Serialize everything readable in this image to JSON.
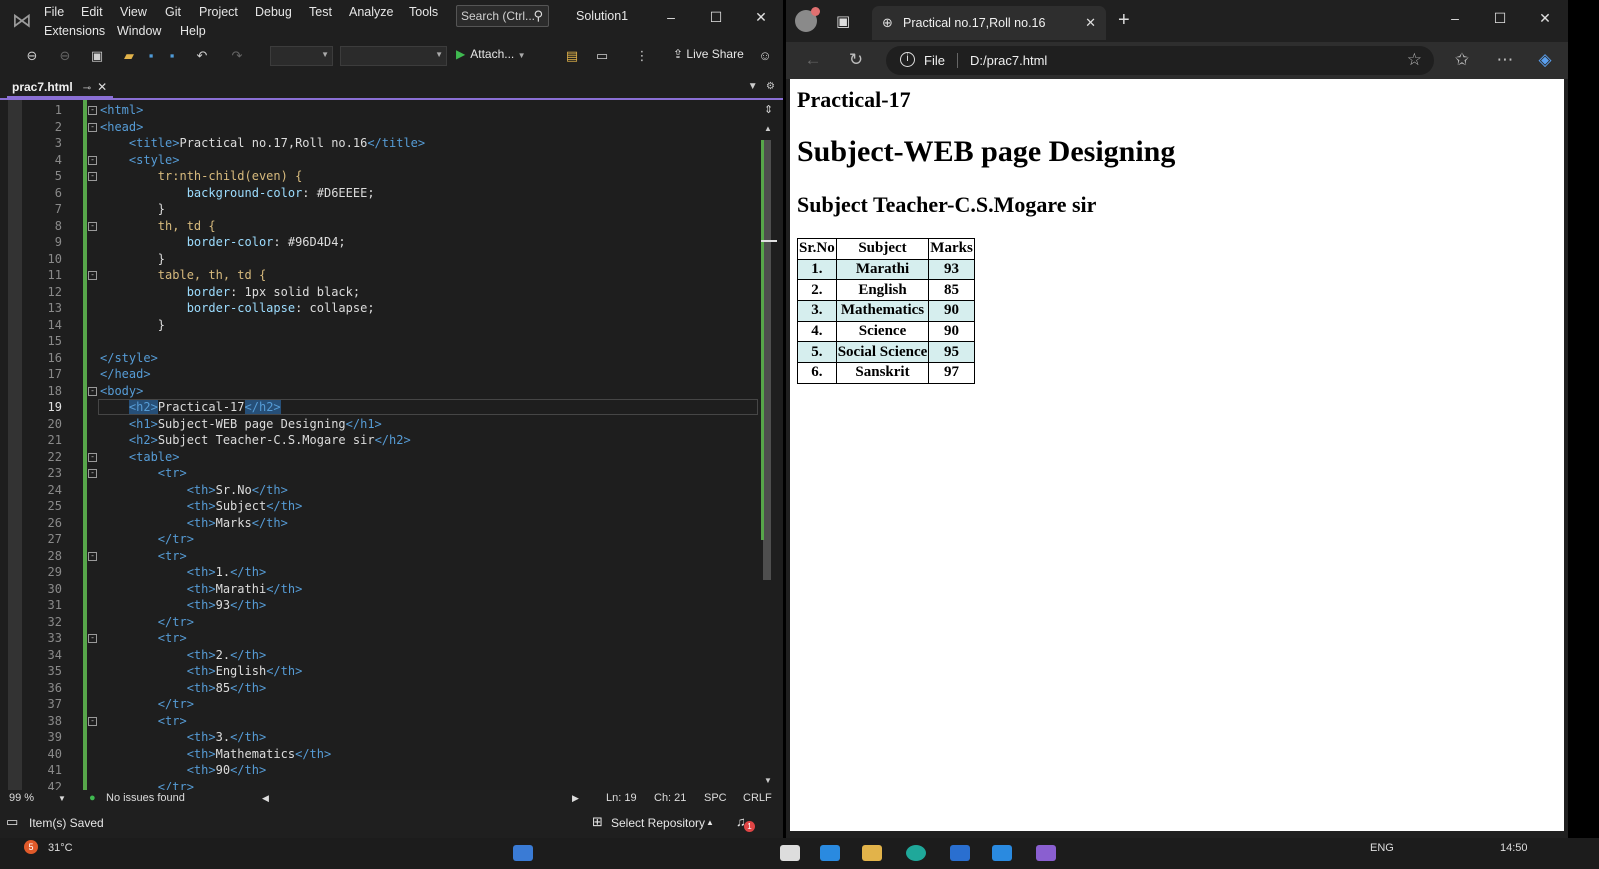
{
  "vs": {
    "menu": [
      "File",
      "Edit",
      "View",
      "Git",
      "Project",
      "Debug",
      "Test",
      "Analyze",
      "Tools",
      "Extensions",
      "Window",
      "Help"
    ],
    "search_placeholder": "Search (Ctrl...",
    "solution_name": "Solution1",
    "toolbar": {
      "attach_label": "Attach...",
      "liveshare_label": "Live Share"
    },
    "doc_tab": "prac7.html",
    "code_lines": [
      "1",
      "2",
      "3",
      "4",
      "5",
      "6",
      "7",
      "8",
      "9",
      "10",
      "11",
      "12",
      "13",
      "14",
      "15",
      "16",
      "17",
      "18",
      "19",
      "20",
      "21",
      "22",
      "23",
      "24",
      "25",
      "26",
      "27",
      "28",
      "29",
      "30",
      "31",
      "32",
      "33",
      "34",
      "35",
      "36",
      "37",
      "38",
      "39",
      "40",
      "41",
      "42"
    ],
    "code": {
      "l1": "<html>",
      "l2": "<head>",
      "l3a": "<title>",
      "l3b": "Practical no.17,Roll no.16",
      "l3c": "</title>",
      "l4": "<style>",
      "l5": "tr:nth-child(even) {",
      "l6a": "background-color",
      "l6b": ": #D6EEEE;",
      "l7": "}",
      "l8": "th, td {",
      "l9a": "border-color",
      "l9b": ": #96D4D4;",
      "l10": "}",
      "l11": "table, th, td {",
      "l12a": "border",
      "l12b": ": 1px solid black;",
      "l13a": "border-collapse",
      "l13b": ": collapse;",
      "l14": "}",
      "l16": "</style>",
      "l17": "</head>",
      "l18": "<body>",
      "l19a": "<h2>",
      "l19b": "Practical-17",
      "l19c": "</h2>",
      "l20a": "<h1>",
      "l20b": "Subject-WEB page Designing",
      "l20c": "</h1>",
      "l21a": "<h2>",
      "l21b": "Subject Teacher-C.S.Mogare sir",
      "l21c": "</h2>",
      "l22": "<table>",
      "tr_open": "<tr>",
      "tr_close": "</tr>",
      "th_open": "<th>",
      "th_close": "</th>",
      "l24": "Sr.No",
      "l25": "Subject",
      "l26": "Marks",
      "l29": "1.",
      "l30": "Marathi",
      "l31": "93",
      "l34": "2.",
      "l35": "English",
      "l36": "85",
      "l39": "3.",
      "l40": "Mathematics",
      "l41": "90"
    },
    "info_bar": {
      "zoom": "99 %",
      "issues": "No issues found",
      "ln": "Ln: 19",
      "ch": "Ch: 21",
      "spc": "SPC",
      "eol": "CRLF"
    },
    "status": {
      "saved": "Item(s) Saved",
      "repo": "Select Repository",
      "notif_count": "1"
    }
  },
  "edge": {
    "tab_title": "Practical no.17,Roll no.16",
    "address_scheme": "File",
    "address_url": "D:/prac7.html"
  },
  "page": {
    "h2a": "Practical-17",
    "h1": "Subject-WEB page Designing",
    "h2b": "Subject Teacher-C.S.Mogare sir",
    "table": {
      "headers": [
        "Sr.No",
        "Subject",
        "Marks"
      ],
      "rows": [
        [
          "1.",
          "Marathi",
          "93"
        ],
        [
          "2.",
          "English",
          "85"
        ],
        [
          "3.",
          "Mathematics",
          "90"
        ],
        [
          "4.",
          "Science",
          "90"
        ],
        [
          "5.",
          "Social Science",
          "95"
        ],
        [
          "6.",
          "Sanskrit",
          "97"
        ]
      ]
    }
  },
  "taskbar": {
    "temp": "31°C",
    "weather_badge": "5",
    "lang": "ENG",
    "time": "14:50"
  },
  "colors": {
    "vs_accent": "#8a6fd4",
    "change_bar": "#57a64a",
    "even_row": "#D6EEEE",
    "tag": "#569cd6",
    "selector": "#d7ba7d",
    "property": "#9cdcfe"
  }
}
